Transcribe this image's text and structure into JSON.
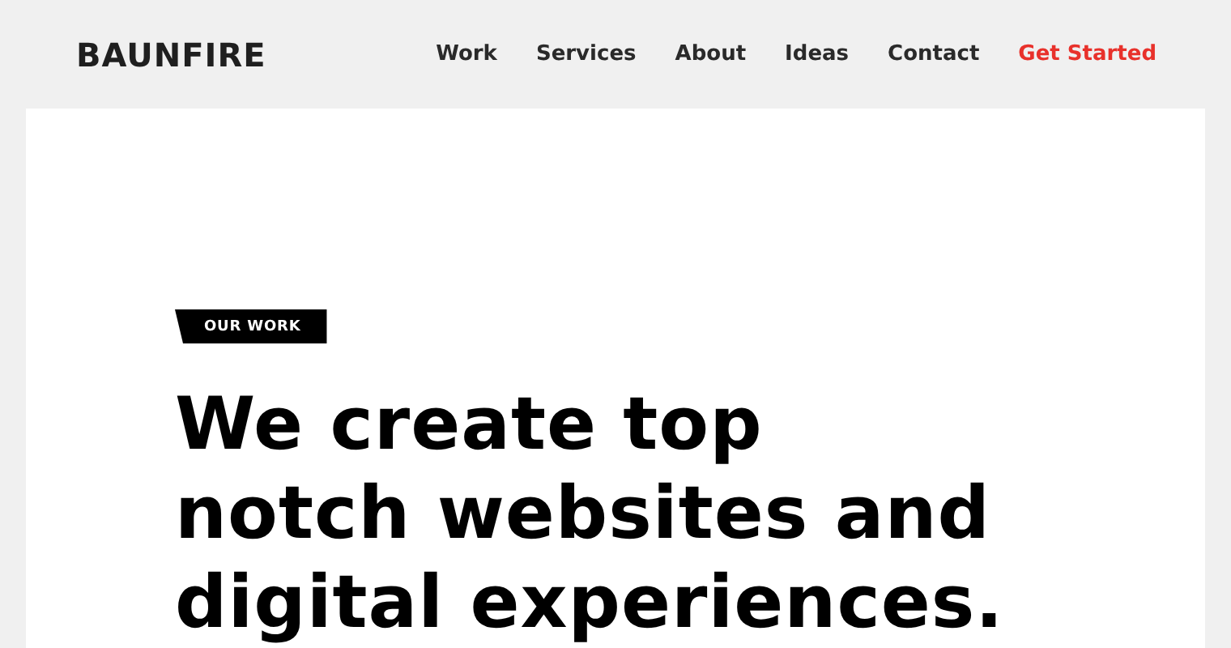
{
  "header": {
    "logo": "BAUNFIRE",
    "nav": [
      {
        "label": "Work",
        "kind": "link"
      },
      {
        "label": "Services",
        "kind": "link"
      },
      {
        "label": "About",
        "kind": "link"
      },
      {
        "label": "Ideas",
        "kind": "link"
      },
      {
        "label": "Contact",
        "kind": "link"
      },
      {
        "label": "Get Started",
        "kind": "cta"
      }
    ]
  },
  "hero": {
    "tag": "OUR WORK",
    "heading": "We create top notch websites and digital experiences."
  }
}
